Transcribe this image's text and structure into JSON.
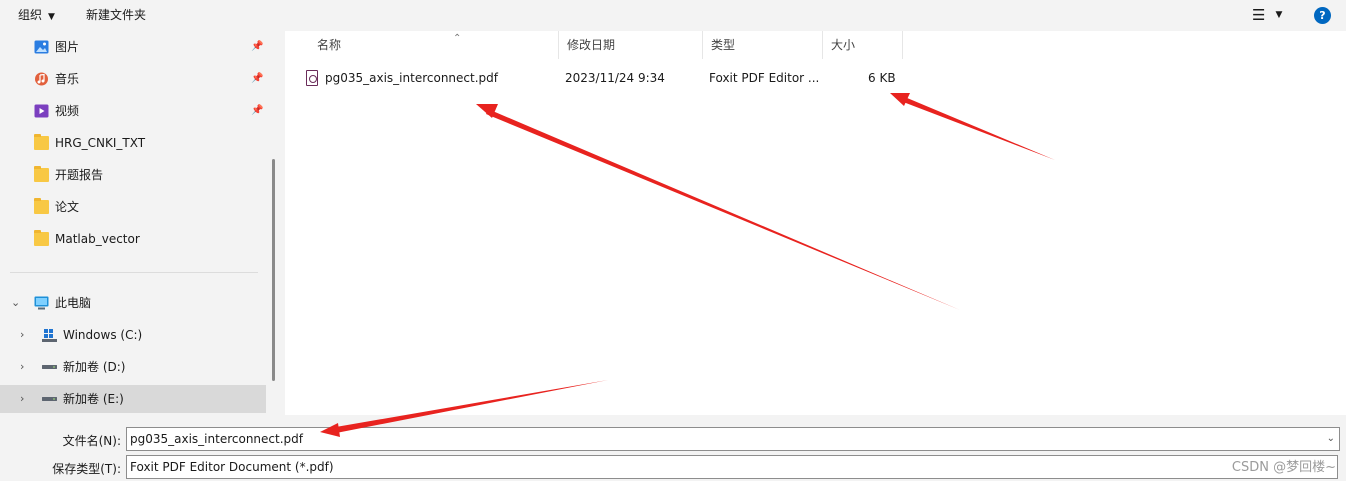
{
  "toolbar": {
    "organize_label": "组织",
    "new_folder_label": "新建文件夹",
    "help_label": "?"
  },
  "sidebar": {
    "quick_access": [
      {
        "label": "图片",
        "icon": "pictures-icon"
      },
      {
        "label": "音乐",
        "icon": "music-icon"
      },
      {
        "label": "视频",
        "icon": "videos-icon"
      },
      {
        "label": "HRG_CNKI_TXT",
        "icon": "folder-icon"
      },
      {
        "label": "开题报告",
        "icon": "folder-icon"
      },
      {
        "label": "论文",
        "icon": "folder-icon"
      },
      {
        "label": "Matlab_vector",
        "icon": "folder-icon"
      }
    ],
    "this_pc_label": "此电脑",
    "drives": [
      {
        "label": "Windows (C:)",
        "icon": "windows-drive-icon"
      },
      {
        "label": "新加卷 (D:)",
        "icon": "drive-icon"
      },
      {
        "label": "新加卷 (E:)",
        "icon": "drive-icon",
        "selected": true
      }
    ]
  },
  "file_list": {
    "columns": [
      "名称",
      "修改日期",
      "类型",
      "大小"
    ],
    "rows": [
      {
        "name": "pg035_axis_interconnect.pdf",
        "modified": "2023/11/24 9:34",
        "type": "Foxit PDF Editor ...",
        "size": "6 KB",
        "icon": "pdf-file-icon"
      }
    ]
  },
  "bottom": {
    "filename_label": "文件名(N):",
    "filename_value": "pg035_axis_interconnect.pdf",
    "filetype_label": "保存类型(T):",
    "filetype_value": "Foxit PDF Editor Document (*.pdf)"
  },
  "watermark": "CSDN @梦回楼~",
  "colors": {
    "chrome_bg": "#f3f3f3",
    "selection_bg": "#d9d9d9",
    "accent": "#0067c0",
    "annotation_arrow": "#e8231f"
  }
}
